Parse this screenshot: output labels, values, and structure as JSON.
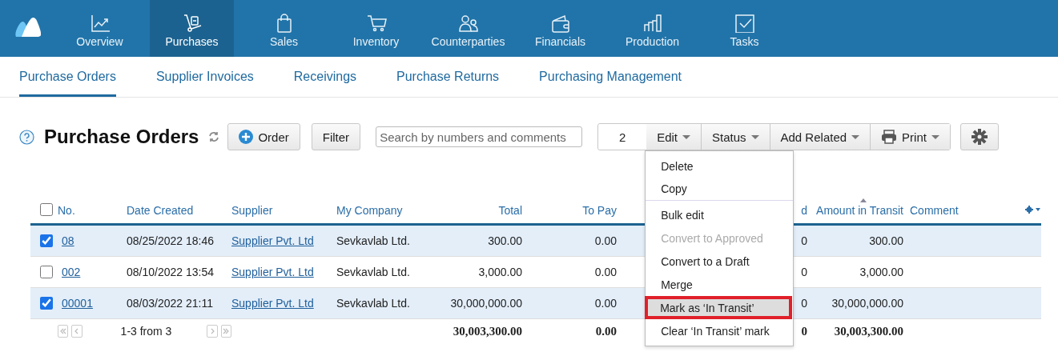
{
  "nav_items": [
    {
      "label": "Overview",
      "selected": false
    },
    {
      "label": "Purchases",
      "selected": true
    },
    {
      "label": "Sales",
      "selected": false
    },
    {
      "label": "Inventory",
      "selected": false
    },
    {
      "label": "Counterparties",
      "selected": false
    },
    {
      "label": "Financials",
      "selected": false
    },
    {
      "label": "Production",
      "selected": false
    },
    {
      "label": "Tasks",
      "selected": false
    }
  ],
  "sub_tabs": [
    {
      "label": "Purchase Orders",
      "selected": true
    },
    {
      "label": "Supplier Invoices",
      "selected": false
    },
    {
      "label": "Receivings",
      "selected": false
    },
    {
      "label": "Purchase Returns",
      "selected": false
    },
    {
      "label": "Purchasing Management",
      "selected": false
    }
  ],
  "page_title": "Purchase Orders",
  "toolbar": {
    "order_button": "Order",
    "filter_button": "Filter",
    "search": {
      "placeholder": "Search by numbers and comments"
    },
    "selected_count": "2",
    "actions": [
      "Edit",
      "Status",
      "Add Related",
      "Print"
    ]
  },
  "edit_menu": [
    {
      "label": "Delete",
      "disabled": false,
      "highlighted": false,
      "divider_after": false
    },
    {
      "label": "Copy",
      "disabled": false,
      "highlighted": false,
      "divider_after": true
    },
    {
      "label": "Bulk edit",
      "disabled": false,
      "highlighted": false,
      "divider_after": false
    },
    {
      "label": "Convert to Approved",
      "disabled": true,
      "highlighted": false,
      "divider_after": false
    },
    {
      "label": "Convert to a Draft",
      "disabled": false,
      "highlighted": false,
      "divider_after": false
    },
    {
      "label": "Merge",
      "disabled": false,
      "highlighted": false,
      "divider_after": false
    },
    {
      "label": "Mark as ‘In Transit’",
      "disabled": false,
      "highlighted": true,
      "divider_after": false
    },
    {
      "label": "Clear ‘In Transit’ mark",
      "disabled": false,
      "highlighted": false,
      "divider_after": false
    }
  ],
  "table": {
    "all_checked": false,
    "columns": [
      {
        "label": "No.",
        "sorted": false
      },
      {
        "label": "Date Created",
        "sorted": false
      },
      {
        "label": "Supplier",
        "sorted": false
      },
      {
        "label": "My Company",
        "sorted": false
      },
      {
        "label": "Total",
        "sorted": false
      },
      {
        "label": "To Pay",
        "sorted": false
      },
      {
        "label": "d",
        "sorted": false
      },
      {
        "label": "Amount in Transit",
        "sorted": true
      },
      {
        "label": "Comment",
        "sorted": false
      }
    ],
    "rows": [
      {
        "checked": true,
        "number": "08",
        "date": "08/25/2022 18:46",
        "supplier": "Supplier Pvt. Ltd",
        "company": "Sevkavlab Ltd.",
        "total": "300.00",
        "to_pay": "0.00",
        "column_7": "0",
        "amount_in_transit": "300.00"
      },
      {
        "checked": false,
        "number": "002",
        "date": "08/10/2022 13:54",
        "supplier": "Supplier Pvt. Ltd",
        "company": "Sevkavlab Ltd.",
        "total": "3,000.00",
        "to_pay": "0.00",
        "column_7": "0",
        "amount_in_transit": "3,000.00"
      },
      {
        "checked": true,
        "number": "00001",
        "date": "08/03/2022 21:11",
        "supplier": "Supplier Pvt. Ltd",
        "company": "Sevkavlab Ltd.",
        "total": "30,000,000.00",
        "to_pay": "0.00",
        "column_7": "0",
        "amount_in_transit": "30,000,000.00"
      }
    ],
    "footer": {
      "pager": "1-3 from 3",
      "total": "30,003,300.00",
      "to_pay": "0.00",
      "column_7": "0",
      "amount_in_transit": "30,003,300.00"
    }
  }
}
